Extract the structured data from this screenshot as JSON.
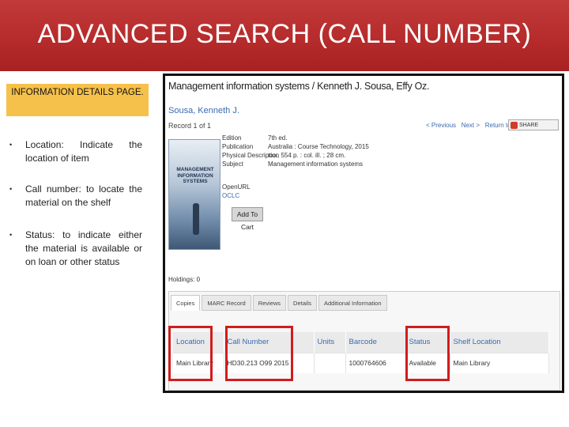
{
  "slide": {
    "title": "ADVANCED SEARCH (CALL NUMBER)",
    "info_box": "INFORMATION DETAILS PAGE.",
    "bullets": [
      "Location: Indicate the location of item",
      "Call number: to locate the material on the shelf",
      "Status: to indicate either the material is available or on loan or other status"
    ],
    "bullet_glyph": "•",
    "banner_color": "#b52a2a",
    "info_box_color": "#f6c14a"
  },
  "record": {
    "title": "Management information systems / Kenneth J. Sousa, Effy Oz.",
    "author": "Sousa, Kenneth J.",
    "count": "Record 1 of 1",
    "nav": {
      "previous": "< Previous",
      "next": "Next >",
      "return": "Return to search"
    },
    "share_label": "SHARE",
    "cover_text": "MANAGEMENT INFORMATION SYSTEMS",
    "fields": [
      {
        "label": "Edition",
        "value": "7th ed."
      },
      {
        "label": "Publication",
        "value": "Australia : Course Technology, 2015"
      },
      {
        "label": "Physical Description",
        "value": "xxx, 554 p. : col. ill. ; 28 cm."
      },
      {
        "label": "Subject",
        "value": "Management information systems"
      }
    ],
    "links": [
      "OpenURL",
      "OCLC"
    ],
    "add_to_cart": "Add To Cart",
    "holdings_label": "Holdings: 0",
    "tabs": [
      "Copies",
      "MARC Record",
      "Reviews",
      "Details",
      "Additional Information"
    ],
    "table": {
      "headers": [
        "Location",
        "Call Number",
        "Units",
        "Barcode",
        "Status",
        "Shelf Location"
      ],
      "row": [
        "Main Library",
        "HD30.213 O99 2015",
        "",
        "1000764606",
        "Available",
        "Main Library"
      ]
    },
    "highlight_color": "#d21c1c",
    "link_color": "#3a6ab0"
  }
}
